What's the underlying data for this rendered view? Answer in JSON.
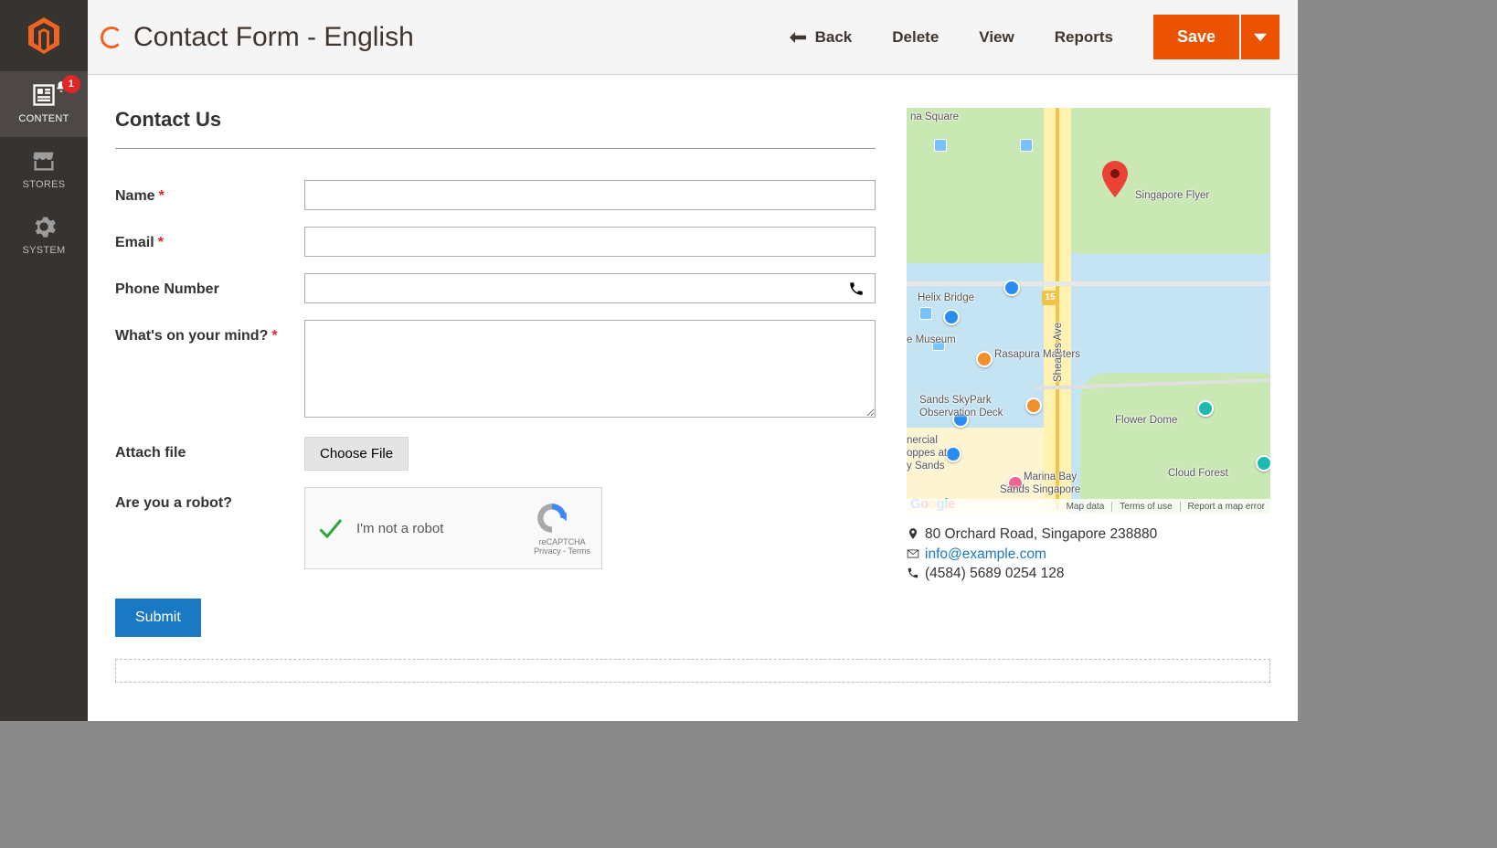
{
  "header": {
    "title": "Contact Form - English",
    "back": "Back",
    "delete": "Delete",
    "view": "View",
    "reports": "Reports",
    "save": "Save"
  },
  "rail": {
    "badge": "1",
    "items": [
      {
        "label": "CONTENT"
      },
      {
        "label": "STORES"
      },
      {
        "label": "SYSTEM"
      }
    ]
  },
  "form": {
    "section_title": "Contact Us",
    "name_label": "Name",
    "email_label": "Email",
    "phone_label": "Phone Number",
    "mind_label": "What's on your mind?",
    "file_label": "Attach file",
    "file_button": "Choose File",
    "robot_label": "Are you a robot?",
    "recaptcha_text": "I'm not a robot",
    "recaptcha_brand": "reCAPTCHA",
    "recaptcha_privacy": "Privacy - Terms",
    "submit": "Submit"
  },
  "map": {
    "labels": {
      "square": "na Square",
      "flyer": "Singapore Flyer",
      "helix": "Helix Bridge",
      "museum": "e Museum",
      "rasapura": "Rasapura Masters",
      "skypark1": "Sands SkyPark",
      "skypark2": "Observation Deck",
      "shoppes1": "nercial",
      "shoppes2": "oppes at",
      "shoppes3": "y Sands",
      "sheares": "Sheares Ave",
      "flower": "Flower Dome",
      "cloud": "Cloud Forest",
      "marina1": "Marina Bay",
      "marina2": "Sands Singapore",
      "road_badge": "15"
    },
    "footer": {
      "map_data": "Map data",
      "terms": "Terms of use",
      "report": "Report a map error"
    }
  },
  "contact": {
    "address": "80 Orchard Road, Singapore 238880",
    "email": "info@example.com",
    "phone": "(4584) 5689 0254 128"
  }
}
